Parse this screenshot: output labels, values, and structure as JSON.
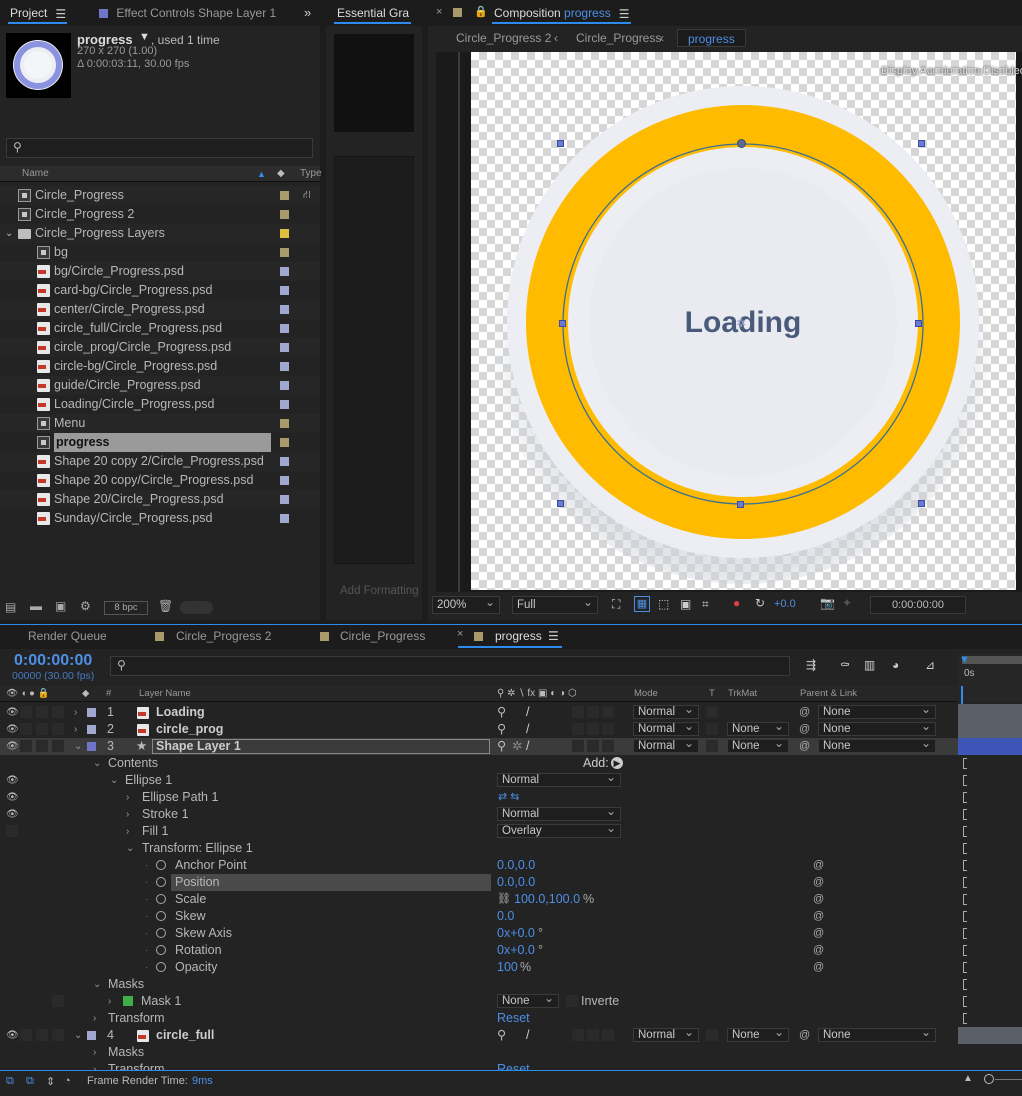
{
  "project_panel": {
    "tabs": [
      "Project",
      "Effect Controls Shape Layer 1"
    ],
    "item_name": "progress",
    "used": ", used 1 time",
    "dims": "270 x 270 (1.00)",
    "duration": "Δ 0:00:03:11, 30.00 fps",
    "col_name": "Name",
    "col_type": "Type",
    "items": [
      {
        "name": "Circle_Progress",
        "type": "comp",
        "indent": 0,
        "label": "#a89a6a"
      },
      {
        "name": "Circle_Progress 2",
        "type": "comp",
        "indent": 0,
        "label": "#a89a6a"
      },
      {
        "name": "Circle_Progress Layers",
        "type": "folder",
        "indent": 0,
        "label": "#e0c040"
      },
      {
        "name": "bg",
        "type": "comp",
        "indent": 1,
        "label": "#a89a6a"
      },
      {
        "name": "bg/Circle_Progress.psd",
        "type": "psd",
        "indent": 1,
        "label": "#a0a8cf"
      },
      {
        "name": "card-bg/Circle_Progress.psd",
        "type": "psd",
        "indent": 1,
        "label": "#a0a8cf"
      },
      {
        "name": "center/Circle_Progress.psd",
        "type": "psd",
        "indent": 1,
        "label": "#a0a8cf"
      },
      {
        "name": "circle_full/Circle_Progress.psd",
        "type": "psd",
        "indent": 1,
        "label": "#a0a8cf"
      },
      {
        "name": "circle_prog/Circle_Progress.psd",
        "type": "psd",
        "indent": 1,
        "label": "#a0a8cf"
      },
      {
        "name": "circle-bg/Circle_Progress.psd",
        "type": "psd",
        "indent": 1,
        "label": "#a0a8cf"
      },
      {
        "name": "guide/Circle_Progress.psd",
        "type": "psd",
        "indent": 1,
        "label": "#a0a8cf"
      },
      {
        "name": "Loading/Circle_Progress.psd",
        "type": "psd",
        "indent": 1,
        "label": "#a0a8cf"
      },
      {
        "name": "Menu",
        "type": "comp",
        "indent": 1,
        "label": "#a89a6a"
      },
      {
        "name": "progress",
        "type": "comp",
        "indent": 1,
        "label": "#a89a6a",
        "selected": true
      },
      {
        "name": "Shape 20 copy 2/Circle_Progress.psd",
        "type": "psd",
        "indent": 1,
        "label": "#a0a8cf"
      },
      {
        "name": "Shape 20 copy/Circle_Progress.psd",
        "type": "psd",
        "indent": 1,
        "label": "#a0a8cf"
      },
      {
        "name": "Shape 20/Circle_Progress.psd",
        "type": "psd",
        "indent": 1,
        "label": "#a0a8cf"
      },
      {
        "name": "Sunday/Circle_Progress.psd",
        "type": "psd",
        "indent": 1,
        "label": "#a0a8cf"
      }
    ],
    "bpc": "8 bpc"
  },
  "essential": {
    "tab": "Essential Gra",
    "footer": "Add Formatting"
  },
  "composition": {
    "tab_prefix": "Composition",
    "tab_name": "progress",
    "breadcrumbs": [
      "Circle_Progress 2",
      "Circle_Progress",
      "progress"
    ],
    "warning": "Display Acceleration Disabled",
    "loading_text": "Loading",
    "zoom": "200%",
    "resolution": "Full",
    "exposure": "+0.0",
    "timecode": "0:00:00:00",
    "ring_color": "#ffbb00",
    "bg_color": "#eceef3"
  },
  "timeline": {
    "tabs": [
      "Render Queue",
      "Circle_Progress 2",
      "Circle_Progress",
      "progress"
    ],
    "timecode": "0:00:00:00",
    "frames": "00000 (30.00 fps)",
    "col_layer": "Layer Name",
    "col_mode": "Mode",
    "col_t": "T",
    "col_trkmat": "TrkMat",
    "col_parent": "Parent & Link",
    "ruler": "0s",
    "layers": [
      {
        "num": "1",
        "name": "Loading",
        "mode": "Normal",
        "trkmat": "",
        "parent": "None"
      },
      {
        "num": "2",
        "name": "circle_prog",
        "mode": "Normal",
        "trkmat": "None",
        "parent": "None"
      },
      {
        "num": "3",
        "name": "Shape Layer 1",
        "mode": "Normal",
        "trkmat": "None",
        "parent": "None"
      }
    ],
    "contents": "Contents",
    "add": "Add:",
    "ellipse": "Ellipse 1",
    "ellipse_mode": "Normal",
    "ellipse_path": "Ellipse Path 1",
    "stroke": "Stroke 1",
    "stroke_mode": "Normal",
    "fill": "Fill 1",
    "fill_mode": "Overlay",
    "transform_group": "Transform: Ellipse 1",
    "props": [
      {
        "name": "Anchor Point",
        "value": "0.0,0.0",
        "unit": ""
      },
      {
        "name": "Position",
        "value": "0.0,0.0",
        "unit": ""
      },
      {
        "name": "Scale",
        "value": "100.0,100.0",
        "unit": "%"
      },
      {
        "name": "Skew",
        "value": "0.0",
        "unit": ""
      },
      {
        "name": "Skew Axis",
        "value": "0x+0.0",
        "unit": "°"
      },
      {
        "name": "Rotation",
        "value": "0x+0.0",
        "unit": "°"
      },
      {
        "name": "Opacity",
        "value": "100",
        "unit": "%"
      }
    ],
    "masks": "Masks",
    "mask1": "Mask 1",
    "mask_mode": "None",
    "inverted": "Inverte",
    "transform": "Transform",
    "reset": "Reset",
    "layer4": {
      "num": "4",
      "name": "circle_full",
      "mode": "Normal",
      "trkmat": "None",
      "parent": "None"
    },
    "masks2": "Masks",
    "transform2": "Transform",
    "reset2": "Reset",
    "render_time_label": "Frame Render Time:",
    "render_time": "9ms"
  }
}
